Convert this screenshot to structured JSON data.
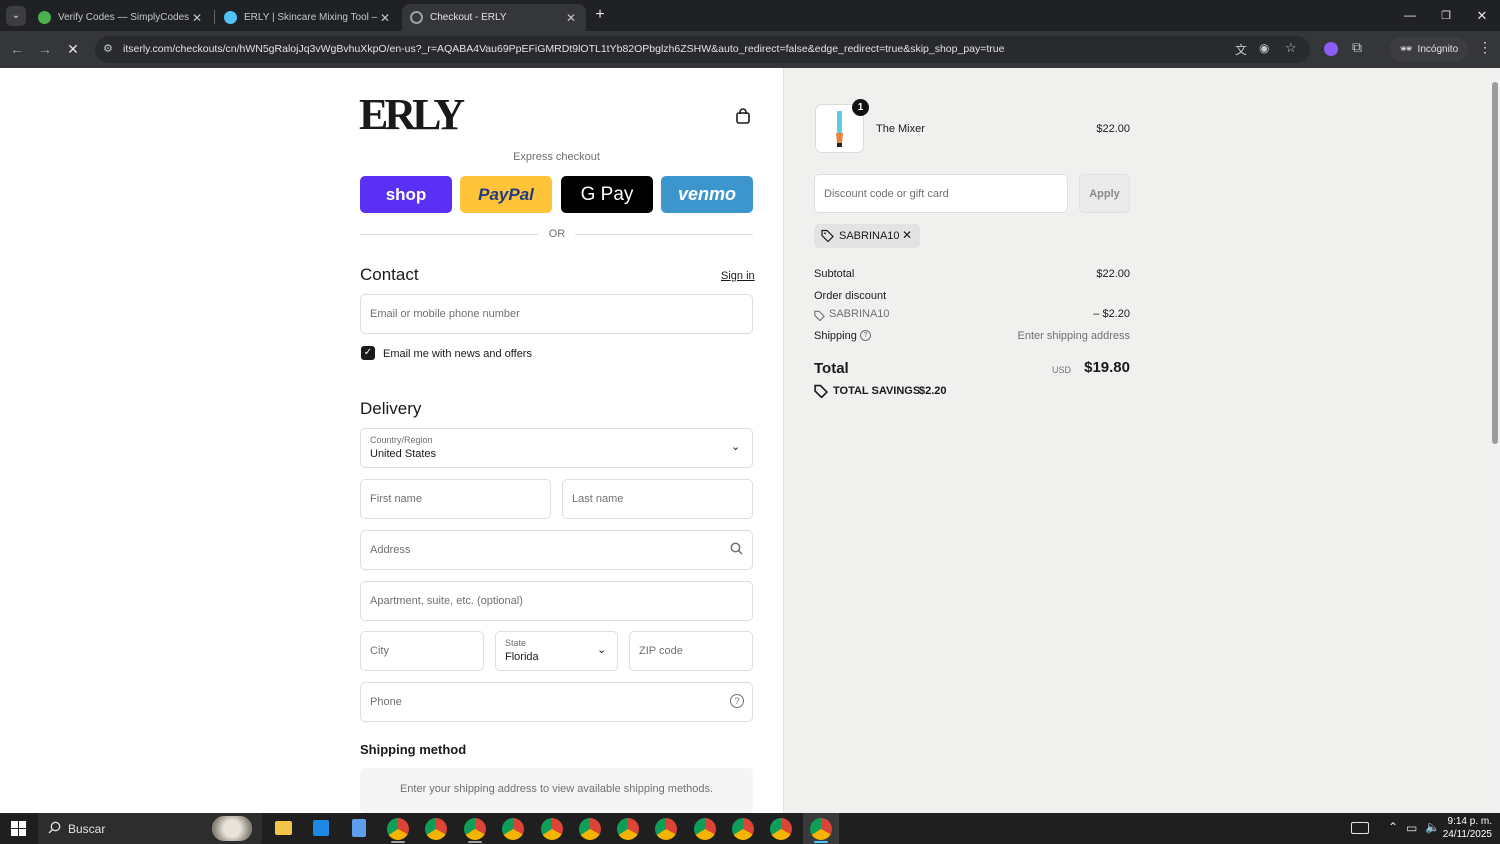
{
  "browser": {
    "tabs": [
      {
        "title": "Verify Codes — SimplyCodes",
        "favicon_color": "#4caf50",
        "active": false
      },
      {
        "title": "ERLY | Skincare Mixing Tool – Th",
        "favicon_color": "#4fc3f7",
        "active": false
      },
      {
        "title": "Checkout - ERLY",
        "favicon_color": "#9aa0a6",
        "active": true
      }
    ],
    "url": "itserly.com/checkouts/cn/hWN5gRalojJq3vWgBvhuXkpO/en-us?_r=AQABA4Vau69PpEFiGMRDt9lOTL1tYb82OPbglzh6ZSHW&auto_redirect=false&edge_redirect=true&skip_shop_pay=true",
    "incognito_label": "Incógnito"
  },
  "checkout": {
    "brand": "ERLY",
    "express_checkout_label": "Express checkout",
    "payment_buttons": [
      {
        "label": "shop",
        "bg": "#5a31f4",
        "color": "#ffffff"
      },
      {
        "label": "PayPal",
        "bg": "#ffc439",
        "color": "#253b80"
      },
      {
        "label": "G Pay",
        "bg": "#000000",
        "color": "#ffffff"
      },
      {
        "label": "venmo",
        "bg": "#3d95ce",
        "color": "#ffffff"
      }
    ],
    "or_label": "OR",
    "contact": {
      "heading": "Contact",
      "sign_in": "Sign in",
      "email_placeholder": "Email or mobile phone number",
      "newsletter_label": "Email me with news and offers",
      "newsletter_checked": true
    },
    "delivery": {
      "heading": "Delivery",
      "country_label": "Country/Region",
      "country_value": "United States",
      "first_name_placeholder": "First name",
      "last_name_placeholder": "Last name",
      "address_placeholder": "Address",
      "apartment_placeholder": "Apartment, suite, etc. (optional)",
      "city_placeholder": "City",
      "state_label": "State",
      "state_value": "Florida",
      "zip_placeholder": "ZIP code",
      "phone_placeholder": "Phone"
    },
    "shipping_method": {
      "heading": "Shipping method",
      "message": "Enter your shipping address to view available shipping methods."
    }
  },
  "summary": {
    "item": {
      "name": "The Mixer",
      "price": "$22.00",
      "quantity": "1"
    },
    "discount_placeholder": "Discount code or gift card",
    "apply_label": "Apply",
    "applied_code": "SABRINA10",
    "subtotal_label": "Subtotal",
    "subtotal_value": "$22.00",
    "order_discount_label": "Order discount",
    "order_discount_code": "SABRINA10",
    "order_discount_value": "– $2.20",
    "shipping_label": "Shipping",
    "shipping_value": "Enter shipping address",
    "total_label": "Total",
    "total_currency": "USD",
    "total_value": "$19.80",
    "savings_label": "TOTAL SAVINGS",
    "savings_value": "$2.20"
  },
  "taskbar": {
    "search_label": "Buscar",
    "time": "9:14 p. m.",
    "date": "24/11/2025"
  }
}
